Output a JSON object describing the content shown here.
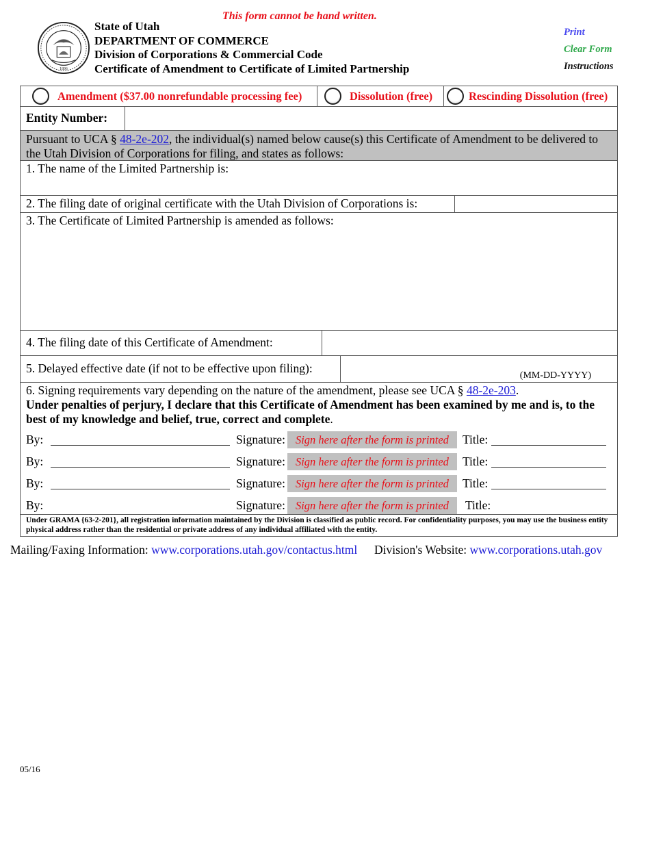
{
  "header": {
    "warning": "This form cannot be hand written.",
    "lines": [
      "State of Utah",
      "DEPARTMENT OF COMMERCE",
      "Division of Corporations & Commercial Code",
      "Certificate of Amendment to Certificate of Limited Partnership"
    ],
    "seal_icon": "state-seal-icon"
  },
  "side_links": {
    "print": "Print",
    "clear_form": "Clear Form",
    "instructions": "Instructions"
  },
  "colors": {
    "warning_red": "#e8101a",
    "print_blue": "#4a4af0",
    "clear_green": "#2ea84a",
    "link_blue": "#1a1ad6",
    "shade_gray": "#c0c0c0"
  },
  "filing_types": [
    {
      "label": "Amendment ($37.00 nonrefundable processing fee)",
      "selected": false
    },
    {
      "label": "Dissolution (free)",
      "selected": false
    },
    {
      "label": "Rescinding Dissolution (free)",
      "selected": false
    }
  ],
  "entity": {
    "label": "Entity Number:",
    "value": ""
  },
  "pursuant": {
    "prefix": "Pursuant to UCA § ",
    "link": "48-2e-202",
    "suffix": ", the individual(s) named below cause(s) this Certificate of Amendment to be delivered to the Utah Division of Corporations for filing, and states as follows:"
  },
  "questions": {
    "q1": "1.  The name of the Limited Partnership is:",
    "q2": "2.  The filing date of original certificate with the Utah Division of Corporations is:",
    "q3": "3.  The Certificate of Limited Partnership is amended as follows:",
    "q4": "4.  The filing date of this Certificate of Amendment:",
    "q5": "5.  Delayed effective date (if not to be effective upon filing):",
    "q5_hint": "(MM-DD-YYYY)",
    "q6_prefix": "6.  Signing requirements vary depending on the nature of the amendment, please see UCA § ",
    "q6_link": "48-2e-203",
    "q6_suffix": ".",
    "perjury": "Under penalties of perjury, I declare that this Certificate of Amendment has been examined by me and is, to the best of my knowledge and belief, true, correct and complete",
    "perjury_end": "."
  },
  "signatures": {
    "by_label": "By:",
    "signature_label": "Signature:",
    "title_label": "Title:",
    "placeholder": "Sign here after the form is printed",
    "rows": 4
  },
  "grama": "Under GRAMA {63-2-201}, all registration information maintained by the Division is classified as public record.  For confidentiality purposes, you may use the business entity physical address rather than the residential or private address of any individual affiliated with the entity.",
  "footer": {
    "mailing_label": "Mailing/Faxing Information:",
    "mailing_url": "www.corporations.utah.gov/contactus.html",
    "website_label": "Division's Website:",
    "website_url": "www.corporations.utah.gov"
  },
  "revision": "05/16"
}
